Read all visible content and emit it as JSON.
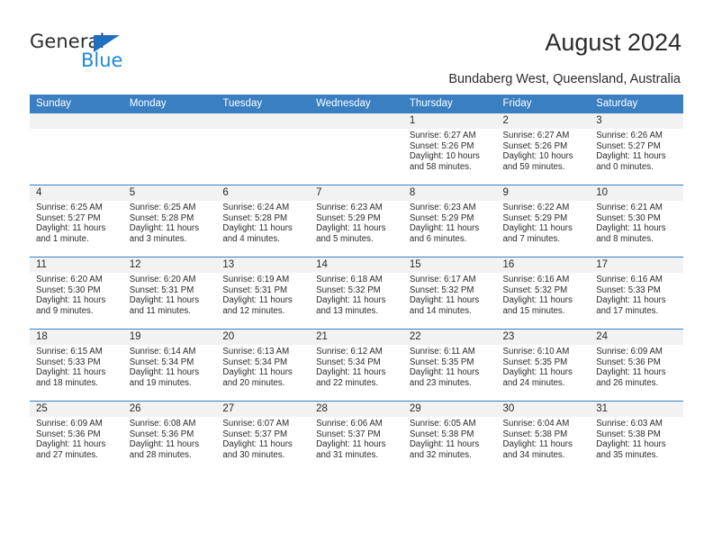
{
  "brand": {
    "name_top": "General",
    "name_bottom": "Blue",
    "triangle_color": "#1f70c1",
    "text_color": "#2e2e2e",
    "blue_color": "#1f88d8"
  },
  "header": {
    "title": "August 2024",
    "subtitle": "Bundaberg West, Queensland, Australia",
    "header_bg": "#3a7fc1",
    "daynum_bg": "#f2f2f2"
  },
  "weekdays": [
    "Sunday",
    "Monday",
    "Tuesday",
    "Wednesday",
    "Thursday",
    "Friday",
    "Saturday"
  ],
  "labels": {
    "sunrise": "Sunrise:",
    "sunset": "Sunset:",
    "daylight": "Daylight:"
  },
  "weeks": [
    [
      {
        "day": "",
        "sunrise": "",
        "sunset": "",
        "daylight": "",
        "empty": true
      },
      {
        "day": "",
        "sunrise": "",
        "sunset": "",
        "daylight": "",
        "empty": true
      },
      {
        "day": "",
        "sunrise": "",
        "sunset": "",
        "daylight": "",
        "empty": true
      },
      {
        "day": "",
        "sunrise": "",
        "sunset": "",
        "daylight": "",
        "empty": true
      },
      {
        "day": "1",
        "sunrise": "Sunrise: 6:27 AM",
        "sunset": "Sunset: 5:26 PM",
        "daylight": "Daylight: 10 hours and 58 minutes."
      },
      {
        "day": "2",
        "sunrise": "Sunrise: 6:27 AM",
        "sunset": "Sunset: 5:26 PM",
        "daylight": "Daylight: 10 hours and 59 minutes."
      },
      {
        "day": "3",
        "sunrise": "Sunrise: 6:26 AM",
        "sunset": "Sunset: 5:27 PM",
        "daylight": "Daylight: 11 hours and 0 minutes."
      }
    ],
    [
      {
        "day": "4",
        "sunrise": "Sunrise: 6:25 AM",
        "sunset": "Sunset: 5:27 PM",
        "daylight": "Daylight: 11 hours and 1 minute."
      },
      {
        "day": "5",
        "sunrise": "Sunrise: 6:25 AM",
        "sunset": "Sunset: 5:28 PM",
        "daylight": "Daylight: 11 hours and 3 minutes."
      },
      {
        "day": "6",
        "sunrise": "Sunrise: 6:24 AM",
        "sunset": "Sunset: 5:28 PM",
        "daylight": "Daylight: 11 hours and 4 minutes."
      },
      {
        "day": "7",
        "sunrise": "Sunrise: 6:23 AM",
        "sunset": "Sunset: 5:29 PM",
        "daylight": "Daylight: 11 hours and 5 minutes."
      },
      {
        "day": "8",
        "sunrise": "Sunrise: 6:23 AM",
        "sunset": "Sunset: 5:29 PM",
        "daylight": "Daylight: 11 hours and 6 minutes."
      },
      {
        "day": "9",
        "sunrise": "Sunrise: 6:22 AM",
        "sunset": "Sunset: 5:29 PM",
        "daylight": "Daylight: 11 hours and 7 minutes."
      },
      {
        "day": "10",
        "sunrise": "Sunrise: 6:21 AM",
        "sunset": "Sunset: 5:30 PM",
        "daylight": "Daylight: 11 hours and 8 minutes."
      }
    ],
    [
      {
        "day": "11",
        "sunrise": "Sunrise: 6:20 AM",
        "sunset": "Sunset: 5:30 PM",
        "daylight": "Daylight: 11 hours and 9 minutes."
      },
      {
        "day": "12",
        "sunrise": "Sunrise: 6:20 AM",
        "sunset": "Sunset: 5:31 PM",
        "daylight": "Daylight: 11 hours and 11 minutes."
      },
      {
        "day": "13",
        "sunrise": "Sunrise: 6:19 AM",
        "sunset": "Sunset: 5:31 PM",
        "daylight": "Daylight: 11 hours and 12 minutes."
      },
      {
        "day": "14",
        "sunrise": "Sunrise: 6:18 AM",
        "sunset": "Sunset: 5:32 PM",
        "daylight": "Daylight: 11 hours and 13 minutes."
      },
      {
        "day": "15",
        "sunrise": "Sunrise: 6:17 AM",
        "sunset": "Sunset: 5:32 PM",
        "daylight": "Daylight: 11 hours and 14 minutes."
      },
      {
        "day": "16",
        "sunrise": "Sunrise: 6:16 AM",
        "sunset": "Sunset: 5:32 PM",
        "daylight": "Daylight: 11 hours and 15 minutes."
      },
      {
        "day": "17",
        "sunrise": "Sunrise: 6:16 AM",
        "sunset": "Sunset: 5:33 PM",
        "daylight": "Daylight: 11 hours and 17 minutes."
      }
    ],
    [
      {
        "day": "18",
        "sunrise": "Sunrise: 6:15 AM",
        "sunset": "Sunset: 5:33 PM",
        "daylight": "Daylight: 11 hours and 18 minutes."
      },
      {
        "day": "19",
        "sunrise": "Sunrise: 6:14 AM",
        "sunset": "Sunset: 5:34 PM",
        "daylight": "Daylight: 11 hours and 19 minutes."
      },
      {
        "day": "20",
        "sunrise": "Sunrise: 6:13 AM",
        "sunset": "Sunset: 5:34 PM",
        "daylight": "Daylight: 11 hours and 20 minutes."
      },
      {
        "day": "21",
        "sunrise": "Sunrise: 6:12 AM",
        "sunset": "Sunset: 5:34 PM",
        "daylight": "Daylight: 11 hours and 22 minutes."
      },
      {
        "day": "22",
        "sunrise": "Sunrise: 6:11 AM",
        "sunset": "Sunset: 5:35 PM",
        "daylight": "Daylight: 11 hours and 23 minutes."
      },
      {
        "day": "23",
        "sunrise": "Sunrise: 6:10 AM",
        "sunset": "Sunset: 5:35 PM",
        "daylight": "Daylight: 11 hours and 24 minutes."
      },
      {
        "day": "24",
        "sunrise": "Sunrise: 6:09 AM",
        "sunset": "Sunset: 5:36 PM",
        "daylight": "Daylight: 11 hours and 26 minutes."
      }
    ],
    [
      {
        "day": "25",
        "sunrise": "Sunrise: 6:09 AM",
        "sunset": "Sunset: 5:36 PM",
        "daylight": "Daylight: 11 hours and 27 minutes."
      },
      {
        "day": "26",
        "sunrise": "Sunrise: 6:08 AM",
        "sunset": "Sunset: 5:36 PM",
        "daylight": "Daylight: 11 hours and 28 minutes."
      },
      {
        "day": "27",
        "sunrise": "Sunrise: 6:07 AM",
        "sunset": "Sunset: 5:37 PM",
        "daylight": "Daylight: 11 hours and 30 minutes."
      },
      {
        "day": "28",
        "sunrise": "Sunrise: 6:06 AM",
        "sunset": "Sunset: 5:37 PM",
        "daylight": "Daylight: 11 hours and 31 minutes."
      },
      {
        "day": "29",
        "sunrise": "Sunrise: 6:05 AM",
        "sunset": "Sunset: 5:38 PM",
        "daylight": "Daylight: 11 hours and 32 minutes."
      },
      {
        "day": "30",
        "sunrise": "Sunrise: 6:04 AM",
        "sunset": "Sunset: 5:38 PM",
        "daylight": "Daylight: 11 hours and 34 minutes."
      },
      {
        "day": "31",
        "sunrise": "Sunrise: 6:03 AM",
        "sunset": "Sunset: 5:38 PM",
        "daylight": "Daylight: 11 hours and 35 minutes."
      }
    ]
  ]
}
